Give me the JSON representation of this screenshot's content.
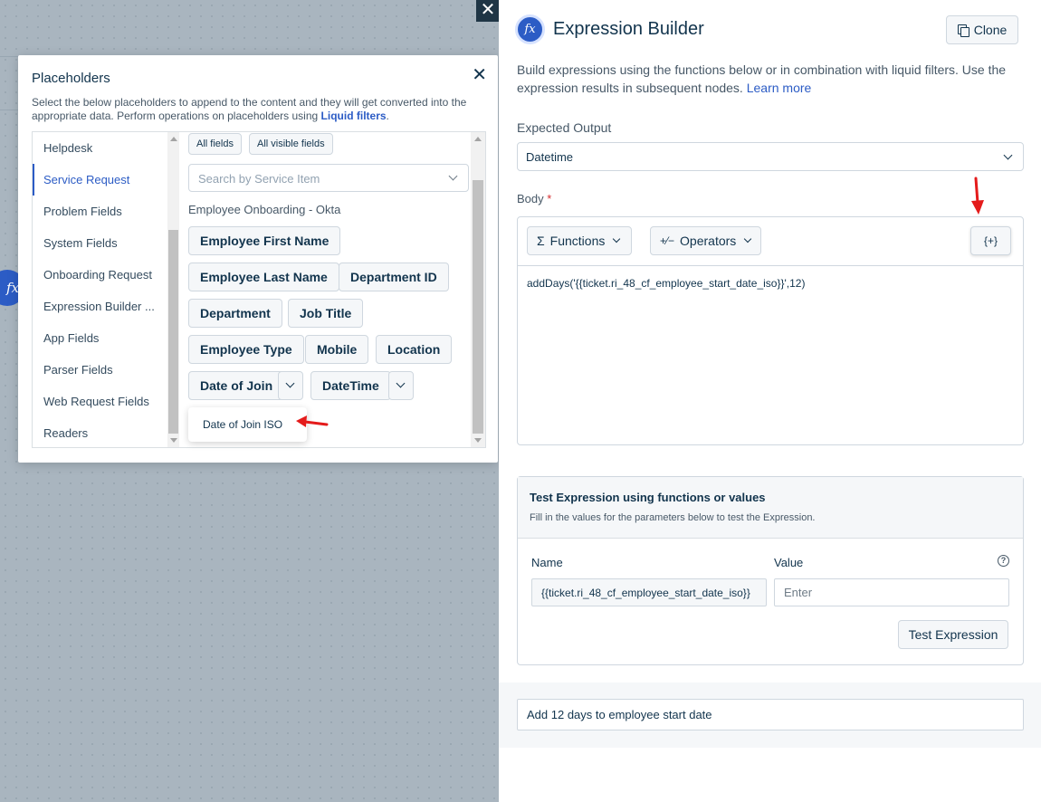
{
  "background": {
    "node_icon": "fx",
    "close_symbol": "✕"
  },
  "placeholders": {
    "title": "Placeholders",
    "close_symbol": "✕",
    "description": "Select the below placeholders to append to the content and they will get converted into the appropriate data. Perform operations on placeholders using",
    "description_link": "Liquid filters",
    "description_end": ".",
    "sidebar": [
      {
        "label": "Helpdesk",
        "active": false
      },
      {
        "label": "Service Request",
        "active": true
      },
      {
        "label": "Problem Fields",
        "active": false
      },
      {
        "label": "System Fields",
        "active": false
      },
      {
        "label": "Onboarding Request",
        "active": false
      },
      {
        "label": "Expression Builder ...",
        "active": false
      },
      {
        "label": "App Fields",
        "active": false
      },
      {
        "label": "Parser Fields",
        "active": false
      },
      {
        "label": "Web Request Fields",
        "active": false
      },
      {
        "label": "Readers",
        "active": false
      }
    ],
    "filter_all": "All fields",
    "filter_visible": "All visible fields",
    "search_placeholder": "Search by Service Item",
    "group_label": "Employee Onboarding - Okta",
    "fields": [
      "Employee First Name",
      "Employee Last Name",
      "Department ID",
      "Department",
      "Job Title",
      "Employee Type",
      "Mobile",
      "Location",
      "Date of Join",
      "DateTime"
    ],
    "dropdown_item": "Date of Join ISO"
  },
  "expression_builder": {
    "logo": "fx",
    "title": "Expression Builder",
    "clone_label": "Clone",
    "description": "Build expressions using the functions below or in combination with liquid filters. Use the expression results in subsequent nodes.",
    "learn_more": "Learn more",
    "expected_output_label": "Expected Output",
    "expected_output_value": "Datetime",
    "body_label": "Body",
    "required_mark": "*",
    "functions_label": "Functions",
    "functions_symbol": "Σ",
    "operators_label": "Operators",
    "operators_symbol": "+⁄−",
    "insert_placeholder_label": "{+}",
    "body_expression": "addDays('{{ticket.ri_48_cf_employee_start_date_iso}}',12)",
    "test": {
      "title": "Test Expression using functions or values",
      "subtitle": "Fill in the values for the parameters below to test the Expression.",
      "name_header": "Name",
      "value_header": "Value",
      "help_symbol": "?",
      "param_name": "{{ticket.ri_48_cf_employee_start_date_iso}}",
      "value_placeholder": "Enter",
      "test_button": "Test Expression"
    },
    "description_field_value": "Add 12 days to employee start date"
  },
  "colors": {
    "accent": "#2c5cc5",
    "annotation_arrow": "#e41b1b",
    "text_primary": "#12344d"
  }
}
